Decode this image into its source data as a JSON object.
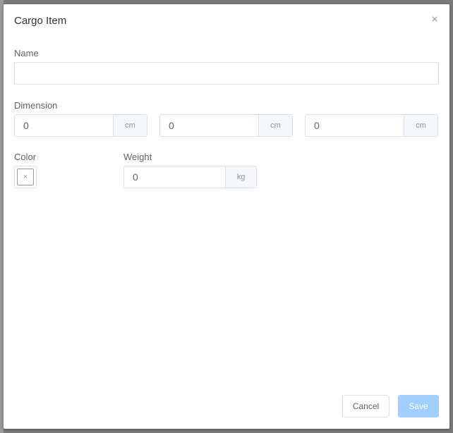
{
  "dialog": {
    "title": "Cargo Item",
    "close_icon": "close-icon"
  },
  "form": {
    "name": {
      "label": "Name",
      "value": ""
    },
    "dimension": {
      "label": "Dimension",
      "fields": [
        {
          "value": "0",
          "unit": "cm"
        },
        {
          "value": "0",
          "unit": "cm"
        },
        {
          "value": "0",
          "unit": "cm"
        }
      ]
    },
    "color": {
      "label": "Color",
      "empty_glyph": "×"
    },
    "weight": {
      "label": "Weight",
      "value": "0",
      "unit": "kg"
    }
  },
  "footer": {
    "cancel_label": "Cancel",
    "save_label": "Save"
  },
  "colors": {
    "primary_disabled": "#a0cfff",
    "border": "#dcdfe6",
    "text": "#606266"
  }
}
